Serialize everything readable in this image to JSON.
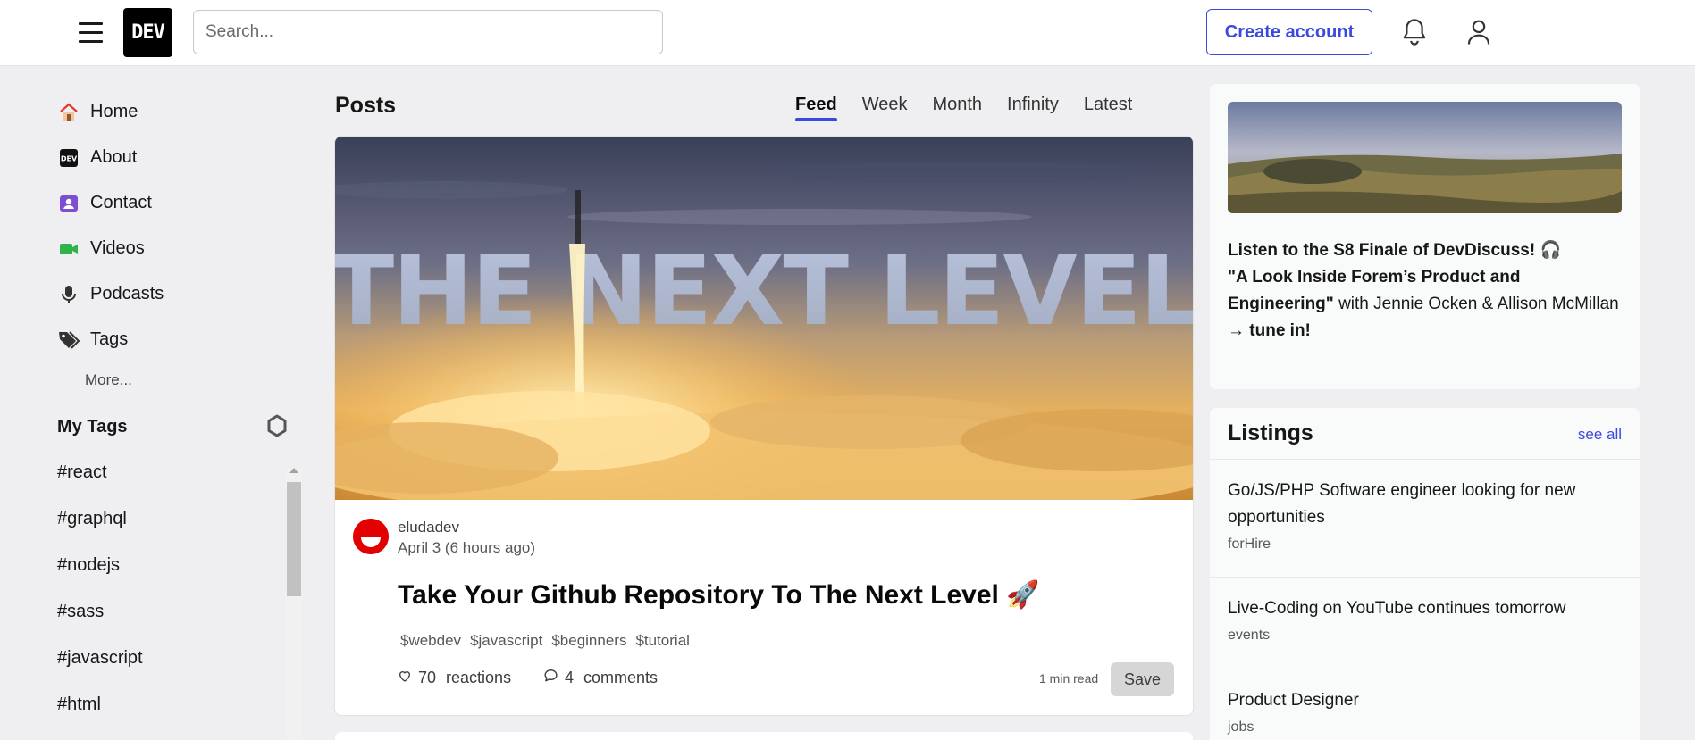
{
  "header": {
    "logo_text": "DEV",
    "search_placeholder": "Search...",
    "create_account_label": "Create account"
  },
  "sidebar": {
    "items": [
      {
        "label": "Home",
        "icon": "house-icon"
      },
      {
        "label": "About",
        "icon": "dev-logo-icon"
      },
      {
        "label": "Contact",
        "icon": "contact-icon"
      },
      {
        "label": "Videos",
        "icon": "video-camera-icon"
      },
      {
        "label": "Podcasts",
        "icon": "microphone-icon"
      },
      {
        "label": "Tags",
        "icon": "tags-icon"
      }
    ],
    "more_label": "More...",
    "my_tags_title": "My Tags",
    "tags": [
      "#react",
      "#graphql",
      "#nodejs",
      "#sass",
      "#javascript",
      "#html"
    ]
  },
  "main": {
    "posts_title": "Posts",
    "tabs": [
      "Feed",
      "Week",
      "Month",
      "Infinity",
      "Latest"
    ],
    "active_tab": "Feed",
    "post": {
      "cover_text": "THE NEXT LEVEL",
      "author": "eludadev",
      "date": "April 3  (6 hours ago)",
      "title": "Take Your Github Repository To The Next Level 🚀",
      "tags": [
        "$webdev",
        "$javascript",
        "$beginners",
        "$tutorial"
      ],
      "reactions_count": "70",
      "reactions_label": "reactions",
      "comments_count": "4",
      "comments_label": "comments",
      "read_time": "1 min read",
      "save_label": "Save"
    }
  },
  "right": {
    "promo": {
      "line1": "Listen to the S8 Finale of DevDiscuss! 🎧",
      "line2_bold": "\"A Look Inside Forem’s Product and Engineering\"",
      "line2_rest": " with Jennie Ocken & Allison McMillan",
      "cta": "→ tune in!"
    },
    "listings_title": "Listings",
    "see_all_label": "see all",
    "listings": [
      {
        "title": "Go/JS/PHP Software engineer looking for new opportunities",
        "category": "forHire"
      },
      {
        "title": "Live-Coding on YouTube continues tomorrow",
        "category": "events"
      },
      {
        "title": "Product Designer",
        "category": "jobs"
      }
    ]
  },
  "colors": {
    "accent": "#3b49df",
    "page_bg": "#efeff1",
    "avatar": "#ee0000"
  }
}
